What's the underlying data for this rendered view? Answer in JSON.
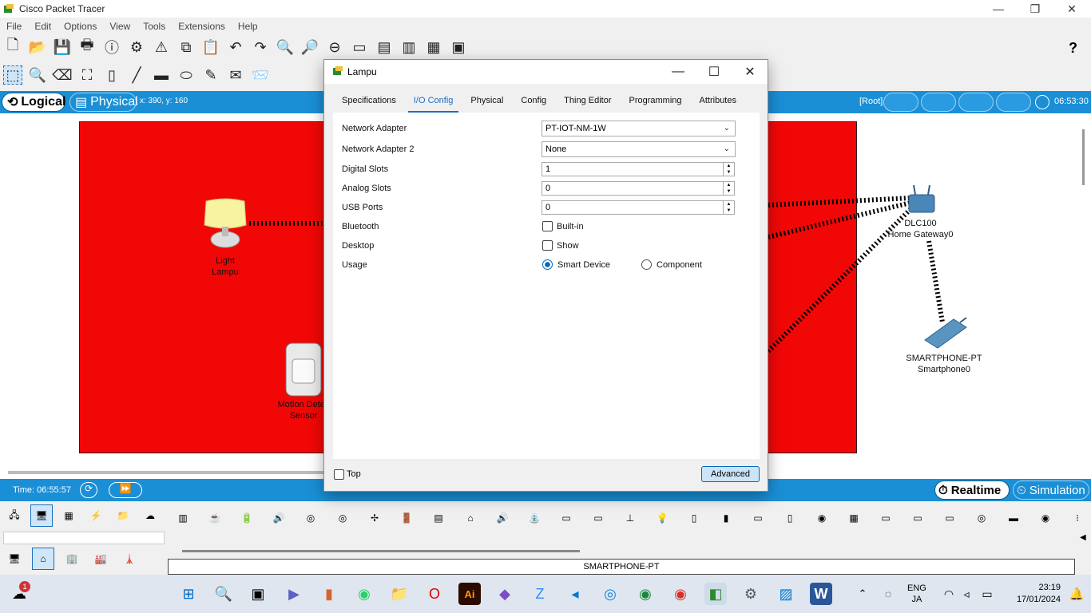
{
  "app": {
    "title": "Cisco Packet Tracer",
    "menu": [
      "File",
      "Edit",
      "Options",
      "View",
      "Tools",
      "Extensions",
      "Help"
    ],
    "toolbar_help": "?"
  },
  "workspace": {
    "logical_label": "Logical",
    "physical_label": "Physical",
    "cursor_coords": "x: 390, y: 160",
    "root_label": "[Root]",
    "clock": "06:53:30"
  },
  "canvas": {
    "devices": [
      {
        "line1": "Light",
        "line2": "Lampu"
      },
      {
        "line1": "Motion Detec",
        "line2": "Sensor"
      },
      {
        "line1": "DLC100",
        "line2": "Home Gateway0"
      },
      {
        "line1": "SMARTPHONE-PT",
        "line2": "Smartphone0"
      }
    ],
    "zone_color": "#f20707"
  },
  "timebar": {
    "time": "Time: 06:55:57",
    "realtime": "Realtime",
    "simulation": "Simulation"
  },
  "tray": {
    "selected_device": "SMARTPHONE-PT"
  },
  "dialog": {
    "title": "Lampu",
    "tabs": [
      "Specifications",
      "I/O Config",
      "Physical",
      "Config",
      "Thing Editor",
      "Programming",
      "Attributes"
    ],
    "active_tab": "I/O Config",
    "network_adapter": {
      "label": "Network Adapter",
      "value": "PT-IOT-NM-1W"
    },
    "network_adapter2": {
      "label": "Network Adapter 2",
      "value": "None"
    },
    "digital_slots": {
      "label": "Digital Slots",
      "value": "1"
    },
    "analog_slots": {
      "label": "Analog Slots",
      "value": "0"
    },
    "usb_ports": {
      "label": "USB Ports",
      "value": "0"
    },
    "bluetooth": {
      "label": "Bluetooth",
      "option": "Built-in",
      "checked": false
    },
    "desktop": {
      "label": "Desktop",
      "option": "Show",
      "checked": false
    },
    "usage": {
      "label": "Usage",
      "option1": "Smart Device",
      "option2": "Component",
      "selected": "Smart Device"
    },
    "top_label": "Top",
    "advanced_label": "Advanced"
  },
  "taskbar": {
    "lang_line1": "ENG",
    "lang_line2": "JA",
    "time": "23:19",
    "date": "17/01/2024",
    "weather_badge": "1"
  }
}
